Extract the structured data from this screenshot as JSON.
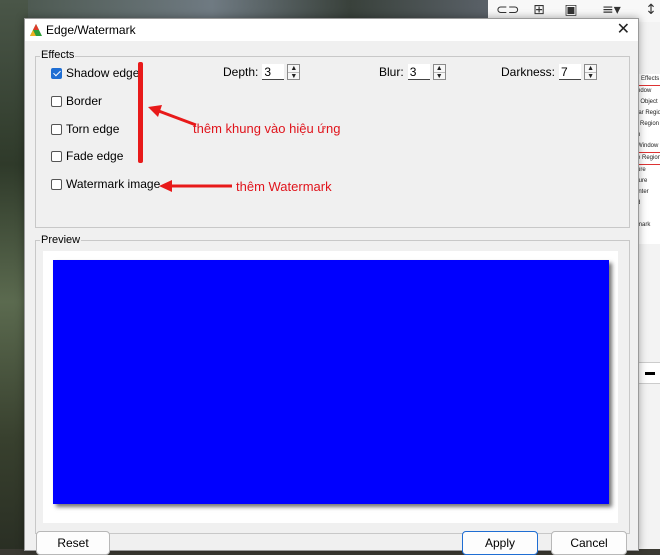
{
  "dialog": {
    "title": "Edge/Watermark",
    "app_icon": "app-logo-icon",
    "close_glyph": "✕"
  },
  "effects": {
    "legend": "Effects",
    "checkboxes": [
      {
        "label": "Shadow edge",
        "checked": true
      },
      {
        "label": "Border",
        "checked": false
      },
      {
        "label": "Torn edge",
        "checked": false
      },
      {
        "label": "Fade edge",
        "checked": false
      },
      {
        "label": "Watermark image",
        "checked": false
      }
    ],
    "spinners": [
      {
        "label": "Depth:",
        "value": "3"
      },
      {
        "label": "Blur:",
        "value": "3"
      },
      {
        "label": "Darkness:",
        "value": "7"
      }
    ]
  },
  "preview": {
    "legend": "Preview",
    "fill_color": "#0000ff"
  },
  "buttons": {
    "reset": "Reset",
    "apply": "Apply",
    "cancel": "Cancel"
  },
  "annotations": {
    "effects_note": "thêm khung vào hiệu ứng",
    "watermark_note": "thêm Watermark",
    "color": "#e81a1a"
  },
  "background_app": {
    "panel_items": [
      "Effects",
      "ndow",
      "/ Object",
      "lar Region",
      "l Region",
      "n",
      "Window",
      "e Region",
      "ure",
      "ture",
      "inter",
      "d",
      "",
      "mark"
    ]
  }
}
